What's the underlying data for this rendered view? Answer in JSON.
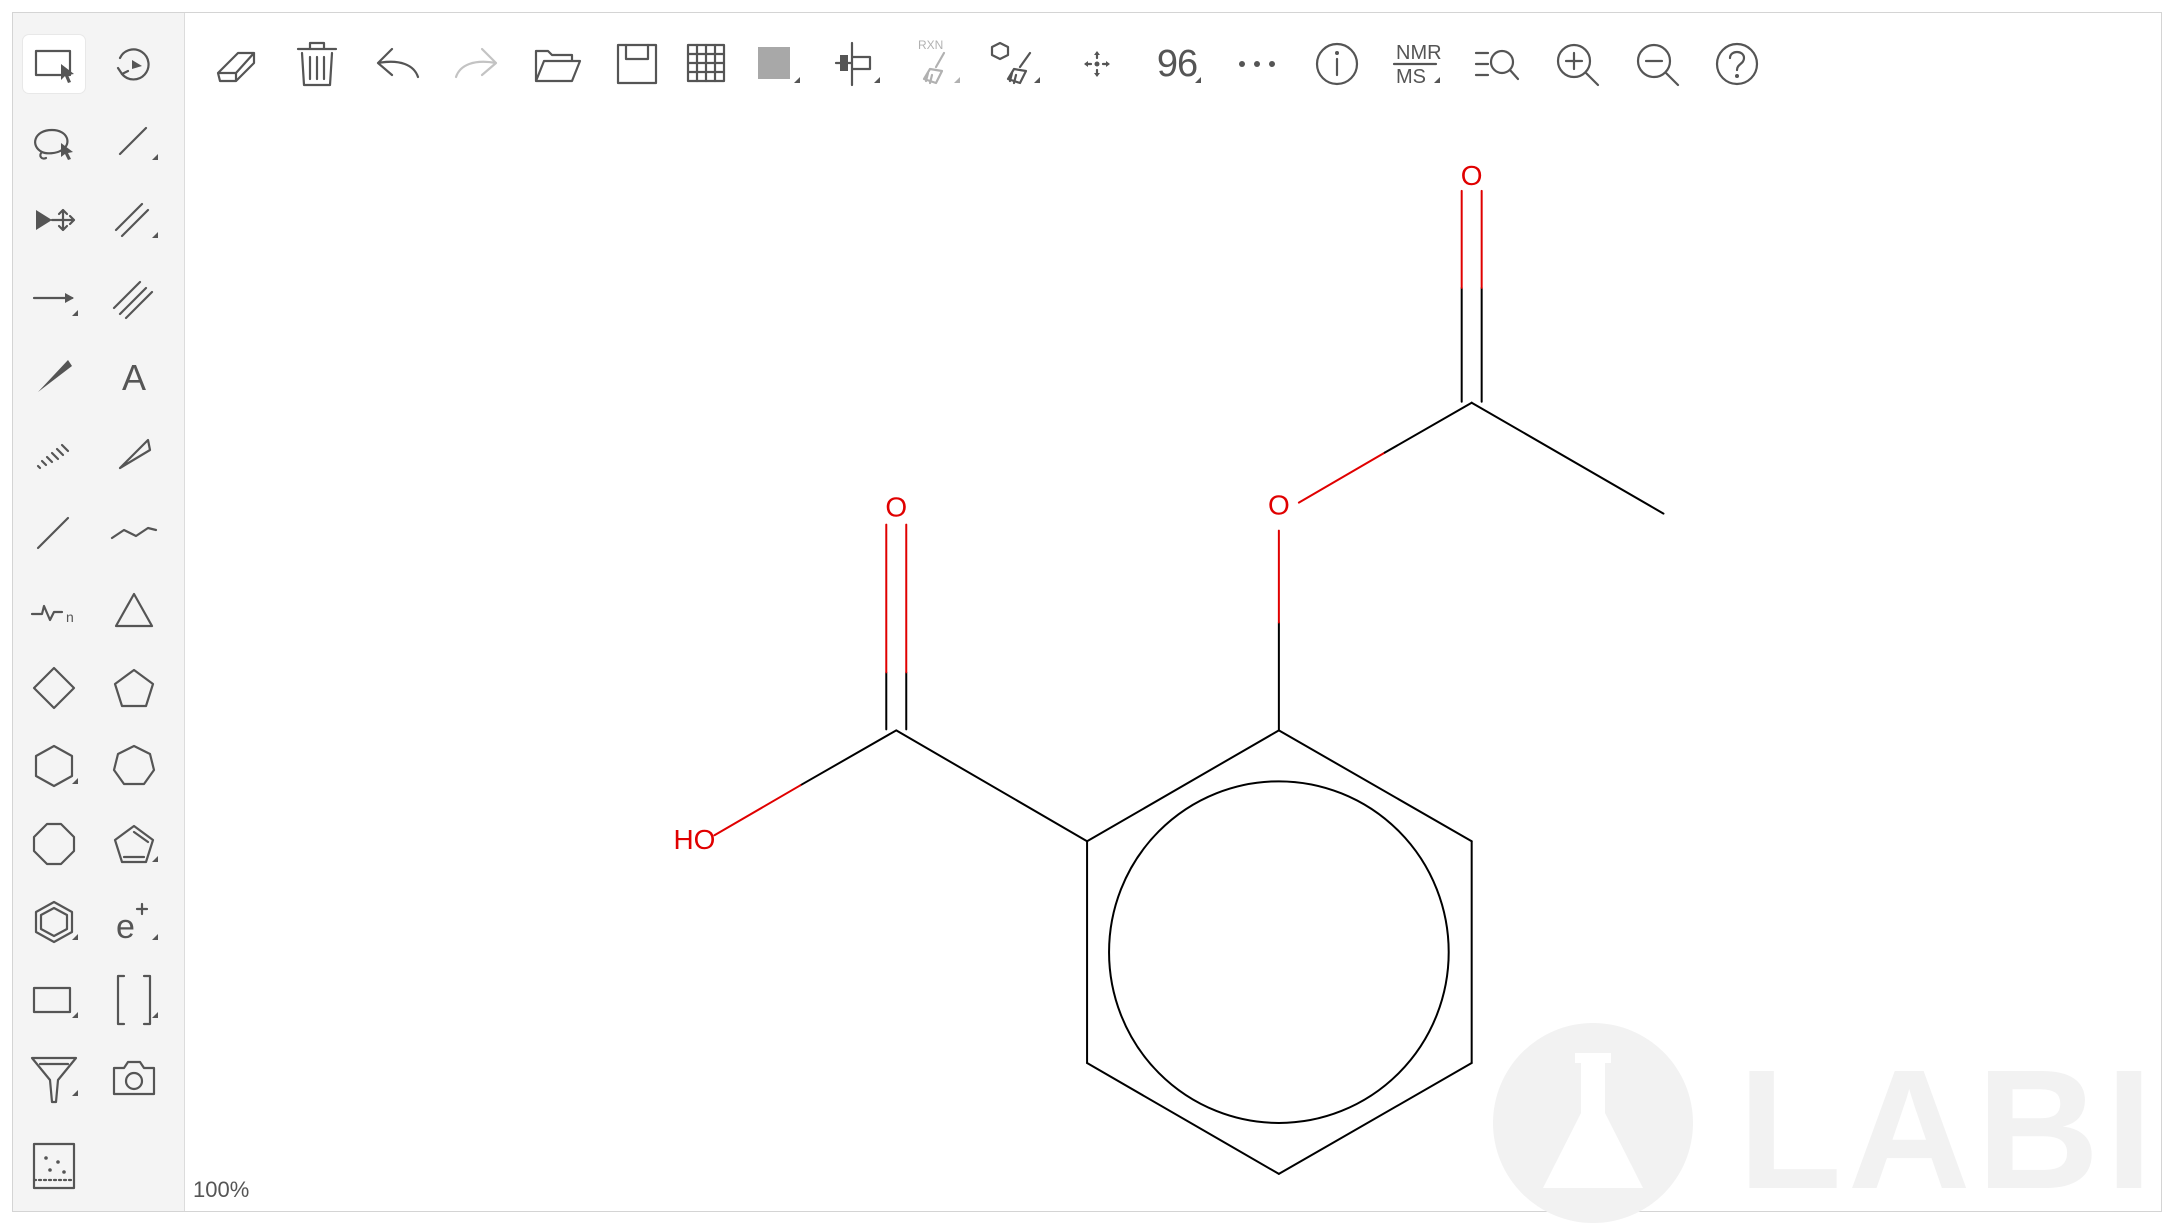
{
  "left_toolbar": {
    "tools": [
      {
        "name": "rectangle-select-icon",
        "selected": true
      },
      {
        "name": "rotate-icon"
      },
      {
        "name": "lasso-select-icon"
      },
      {
        "name": "single-bond-icon"
      },
      {
        "name": "move-icon"
      },
      {
        "name": "double-bond-icon"
      },
      {
        "name": "arrow-icon"
      },
      {
        "name": "triple-bond-icon"
      },
      {
        "name": "wedge-bond-icon"
      },
      {
        "name": "text-icon",
        "label": "A"
      },
      {
        "name": "hashed-bond-icon"
      },
      {
        "name": "hollow-wedge-icon"
      },
      {
        "name": "bold-bond-icon"
      },
      {
        "name": "chain-icon"
      },
      {
        "name": "group-abbreviation-icon",
        "label": "n"
      },
      {
        "name": "cyclopropane-icon"
      },
      {
        "name": "cyclobutane-icon"
      },
      {
        "name": "cyclopentane-icon"
      },
      {
        "name": "cyclohexane-icon"
      },
      {
        "name": "cycloheptane-icon"
      },
      {
        "name": "cyclooctane-icon"
      },
      {
        "name": "cyclopentadiene-icon"
      },
      {
        "name": "benzene-icon"
      },
      {
        "name": "charge-icon",
        "label": "e"
      },
      {
        "name": "shape-rectangle-icon"
      },
      {
        "name": "bracket-icon"
      },
      {
        "name": "funnel-icon"
      },
      {
        "name": "camera-icon"
      },
      {
        "name": "template-icon"
      }
    ]
  },
  "top_toolbar": {
    "buttons": [
      {
        "name": "eraser-icon"
      },
      {
        "name": "trash-icon"
      },
      {
        "name": "undo-icon"
      },
      {
        "name": "redo-icon",
        "disabled": true
      },
      {
        "name": "open-folder-icon"
      },
      {
        "name": "save-icon"
      },
      {
        "name": "grid-icon"
      },
      {
        "name": "color-fill-icon"
      },
      {
        "name": "align-icon"
      },
      {
        "name": "reaction-clean-icon",
        "label": "RXN",
        "disabled": true
      },
      {
        "name": "structure-clean-icon"
      },
      {
        "name": "center-icon"
      },
      {
        "name": "font-size-button",
        "label": "96"
      },
      {
        "name": "more-icon"
      },
      {
        "name": "info-icon"
      },
      {
        "name": "nmr-ms-icon",
        "label_top": "NMR",
        "label_bottom": "MS"
      },
      {
        "name": "search-structure-icon"
      },
      {
        "name": "zoom-in-icon"
      },
      {
        "name": "zoom-out-icon"
      },
      {
        "name": "help-icon"
      }
    ]
  },
  "molecule": {
    "atoms": [
      {
        "label": "O",
        "color": "#e00000"
      },
      {
        "label": "O",
        "color": "#e00000"
      },
      {
        "label": "O",
        "color": "#e00000"
      },
      {
        "label": "HO",
        "color": "#e00000"
      }
    ]
  },
  "status": {
    "zoom": "100%"
  },
  "watermark": {
    "text": "LABII"
  },
  "colors": {
    "heteroatom": "#e00000",
    "bond": "#000000",
    "icon": "#555555",
    "panel": "#f4f4f4"
  }
}
